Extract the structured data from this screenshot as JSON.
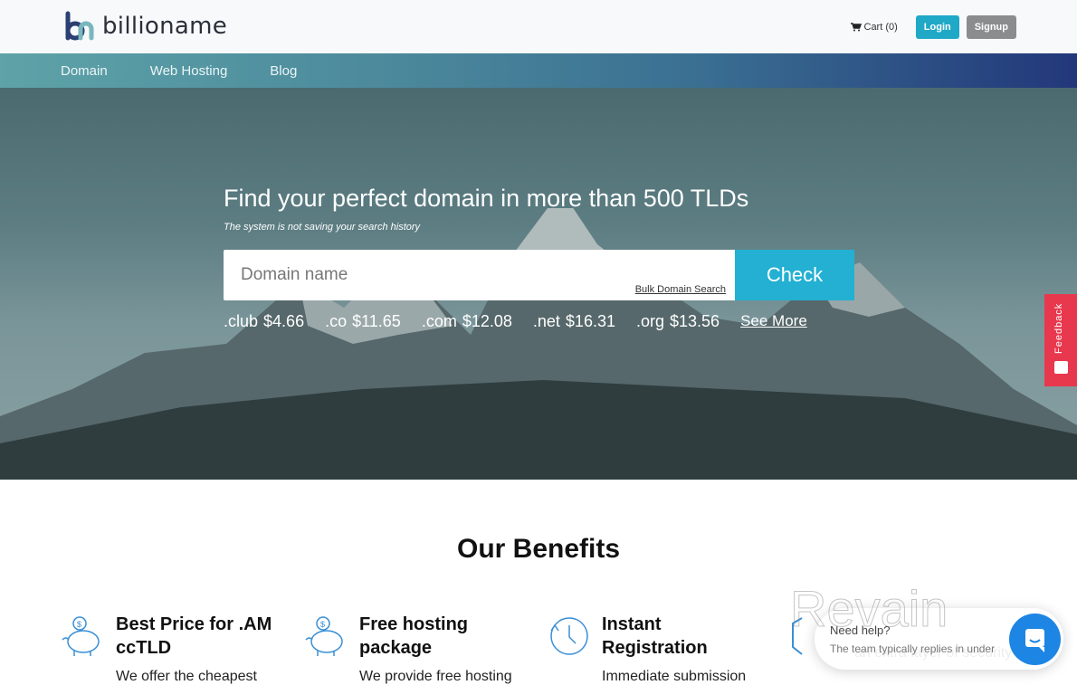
{
  "header": {
    "logo_text": "billioname",
    "cart_label": "Cart (0)",
    "login_label": "Login",
    "signup_label": "Signup",
    "brand_color": "#20a8c7"
  },
  "nav": {
    "items": [
      {
        "label": "Domain"
      },
      {
        "label": "Web Hosting"
      },
      {
        "label": "Blog"
      }
    ]
  },
  "hero": {
    "title": "Find your perfect domain in more than 500 TLDs",
    "subtitle": "The system is not saving your search history",
    "search_placeholder": "Domain name",
    "search_value": "",
    "bulk_link": "Bulk Domain Search",
    "check_label": "Check",
    "prices": [
      {
        "tld": ".club",
        "price": "$4.66"
      },
      {
        "tld": ".co",
        "price": "$11.65"
      },
      {
        "tld": ".com",
        "price": "$12.08"
      },
      {
        "tld": ".net",
        "price": "$16.31"
      },
      {
        "tld": ".org",
        "price": "$13.56"
      }
    ],
    "see_more": "See More"
  },
  "feedback": {
    "label": "Feedback"
  },
  "benefits": {
    "title": "Our Benefits",
    "items": [
      {
        "icon": "piggy-bank-icon",
        "title_line1": "Best Price for .AM",
        "title_line2": "ccTLD",
        "text": "We offer the cheapest"
      },
      {
        "icon": "piggy-bank-icon",
        "title_line1": "Free hosting",
        "title_line2": "package",
        "text": "We provide free hosting"
      },
      {
        "icon": "clock-icon",
        "title_line1": "Instant",
        "title_line2": "Registration",
        "text": "Immediate submission"
      },
      {
        "icon": "shield-icon",
        "title_line1": "",
        "title_line2": "",
        "text": "an extra layer of security"
      }
    ]
  },
  "chat": {
    "title": "Need help?",
    "subtitle": "The team typically replies in under"
  },
  "watermark": "Revain"
}
